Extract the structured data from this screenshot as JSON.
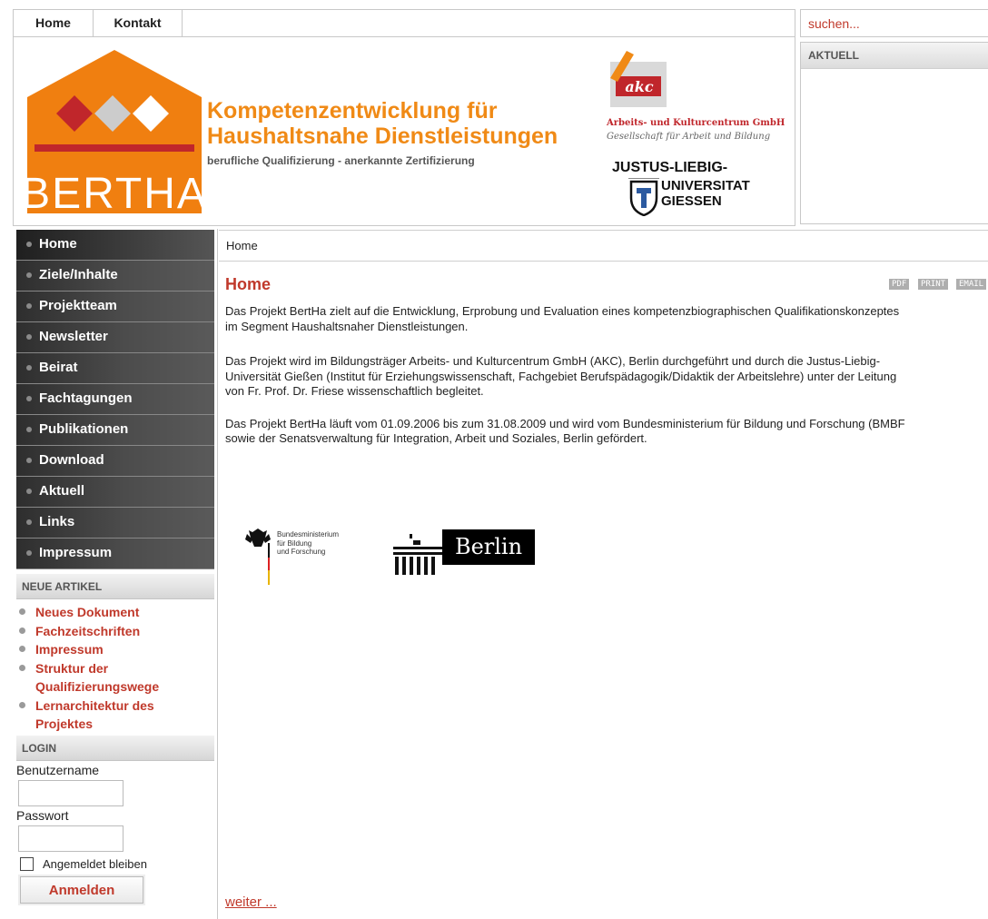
{
  "topnav": {
    "items": [
      {
        "label": "Home"
      },
      {
        "label": "Kontakt"
      }
    ]
  },
  "search": {
    "placeholder": "suchen..."
  },
  "aktuell": {
    "title": "AKTUELL"
  },
  "header": {
    "logo_text": "BERTHA",
    "title_line1": "Kompetenzentwicklung für",
    "title_line2": "Haushaltsnahe Dienstleistungen",
    "subtitle": "berufliche Qualifizierung -  anerkannte Zertifizierung",
    "akc_logo": "akc",
    "akc_name": "Arbeits- und Kulturcentrum GmbH",
    "akc_sub": "Gesellschaft für Arbeit und Bildung",
    "jlu_line1": "JUSTUS-LIEBIG-",
    "jlu_line2": "UNIVERSITAT",
    "jlu_line3": "GIESSEN"
  },
  "sidebar": {
    "menu": [
      {
        "label": "Home"
      },
      {
        "label": "Ziele/Inhalte"
      },
      {
        "label": "Projektteam"
      },
      {
        "label": "Newsletter"
      },
      {
        "label": "Beirat"
      },
      {
        "label": "Fachtagungen"
      },
      {
        "label": "Publikationen"
      },
      {
        "label": "Download"
      },
      {
        "label": "Aktuell"
      },
      {
        "label": "Links"
      },
      {
        "label": "Impressum"
      }
    ],
    "new_articles": {
      "title": "NEUE ARTIKEL",
      "items": [
        {
          "label": "Neues Dokument"
        },
        {
          "label": "Fachzeitschriften"
        },
        {
          "label": "Impressum"
        },
        {
          "label": "Struktur der Qualifizierungswege"
        },
        {
          "label": "Lernarchitektur des Projektes"
        }
      ]
    },
    "login": {
      "title": "LOGIN",
      "username_label": "Benutzername",
      "password_label": "Passwort",
      "remember_label": "Angemeldet bleiben",
      "submit_label": "Anmelden"
    }
  },
  "content": {
    "breadcrumb": "Home",
    "title": "Home",
    "tools": {
      "pdf": "PDF",
      "print": "PRINT",
      "email": "EMAIL"
    },
    "paragraphs": [
      "Das Projekt BertHa zielt auf die Entwicklung, Erprobung und Evaluation eines kompetenzbiographischen Qualifikationskonzeptes",
      "im Segment Haushaltsnaher Dienstleistungen.",
      "Das Projekt wird im Bildungsträger Arbeits- und Kulturcentrum GmbH (AKC), Berlin durchgeführt und durch die Justus-Liebig-",
      "Universität Gießen (Institut für Erziehungswissenschaft, Fachgebiet Berufspädagogik/Didaktik der Arbeitslehre) unter der Leitung",
      "von Fr. Prof. Dr. Friese wissenschaftlich begleitet.",
      "Das Projekt BertHa läuft vom 01.09.2006 bis zum 31.08.2009 und wird vom Bundesministerium für Bildung und Forschung (BMBF",
      "sowie der Senatsverwaltung für Integration, Arbeit und Soziales, Berlin gefördert."
    ],
    "bmbf": {
      "line1": "Bundesministerium",
      "line2": "für Bildung",
      "line3": "und Forschung"
    },
    "berlin": "Berlin",
    "more": "weiter ..."
  }
}
